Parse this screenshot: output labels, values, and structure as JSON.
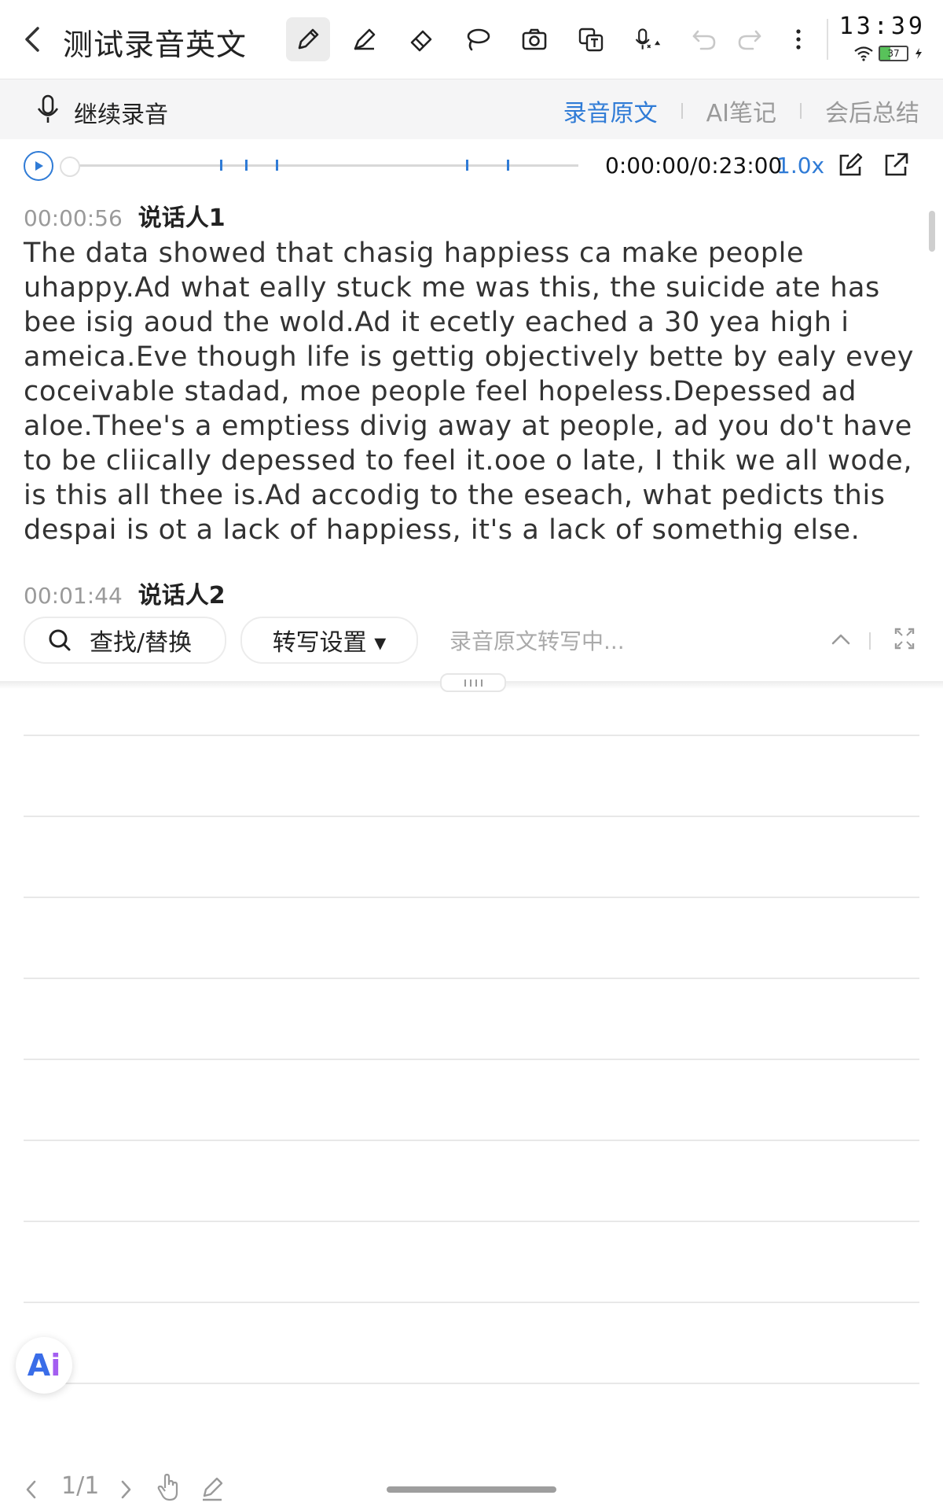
{
  "header": {
    "back_icon": "chevron-left-icon",
    "title": "测试录音英文",
    "tools": [
      "pen-icon",
      "highlighter-icon",
      "eraser-icon",
      "lasso-icon",
      "camera-icon",
      "translate-icon",
      "mic-settings-icon",
      "undo-icon",
      "redo-icon",
      "more-icon"
    ],
    "time": "13:39",
    "battery": "37"
  },
  "subbar": {
    "continue_label": "继续录音",
    "tabs": [
      {
        "label": "录音原文"
      },
      {
        "label": "AI笔记"
      },
      {
        "label": "会后总结"
      }
    ],
    "active_tab": "录音原文"
  },
  "player": {
    "progress": 0.0,
    "marks": [
      0.3,
      0.35,
      0.41,
      0.78,
      0.86
    ],
    "time": "0:00:00/0:23:00",
    "speed": "1.0x"
  },
  "transcript": {
    "segments": [
      {
        "time": "00:00:56",
        "speaker": "说话人1",
        "text": "The data showed that chasig happiess ca make people uhappy.Ad what eally stuck me was this, the suicide ate has bee isig aoud the wold.Ad it ecetly eached a 30 yea high i ameica.Eve though life is gettig objectively bette by ealy evey coceivable stadad, moe people feel hopeless.Depessed ad aloe.Thee's a emptiess divig away at people, ad you do't have to be cliically depessed to feel it.ooe o late, I thik we all wode, is this all thee is.Ad accodig to the eseach, what pedicts this despai is ot a lack of happiess, it's a lack of somethig else."
      },
      {
        "time": "00:01:44",
        "speaker": "说话人2",
        "text": ""
      }
    ]
  },
  "toolbar": {
    "find_label": "查找/替换",
    "settings_label": "转写设置 ▾",
    "status": "录音原文转写中..."
  },
  "ai_button": {
    "a": "A",
    "i": "i"
  },
  "footer": {
    "page": "1/1"
  },
  "colors": {
    "accent": "#2f7bd6",
    "muted": "#9a9a9a"
  }
}
